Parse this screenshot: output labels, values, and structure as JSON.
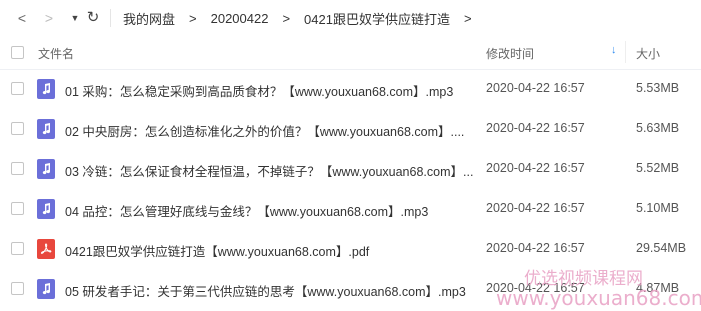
{
  "nav": {
    "back_glyph": "<",
    "forward_glyph": ">",
    "dropdown_glyph": "▼",
    "refresh_glyph": "↻"
  },
  "breadcrumb": {
    "items": [
      "我的网盘",
      "20200422",
      "0421跟巴奴学供应链打造"
    ],
    "separator": ">"
  },
  "header": {
    "name_label": "文件名",
    "time_label": "修改时间",
    "sort_arrow": "↓",
    "size_label": "大小"
  },
  "files": [
    {
      "type": "audio",
      "icon": "music-note-icon",
      "name": "01 采购：怎么稳定采购到高品质食材？【www.youxuan68.com】.mp3",
      "modified": "2020-04-22 16:57",
      "size": "5.53MB"
    },
    {
      "type": "audio",
      "icon": "music-note-icon",
      "name": "02 中央厨房：怎么创造标准化之外的价值？【www.youxuan68.com】....",
      "modified": "2020-04-22 16:57",
      "size": "5.63MB"
    },
    {
      "type": "audio",
      "icon": "music-note-icon",
      "name": "03 冷链：怎么保证食材全程恒温，不掉链子？【www.youxuan68.com】...",
      "modified": "2020-04-22 16:57",
      "size": "5.52MB"
    },
    {
      "type": "audio",
      "icon": "music-note-icon",
      "name": "04 品控：怎么管理好底线与金线？【www.youxuan68.com】.mp3",
      "modified": "2020-04-22 16:57",
      "size": "5.10MB"
    },
    {
      "type": "pdf",
      "icon": "pdf-icon",
      "name": "0421跟巴奴学供应链打造【www.youxuan68.com】.pdf",
      "modified": "2020-04-22 16:57",
      "size": "29.54MB"
    },
    {
      "type": "audio",
      "icon": "music-note-icon",
      "name": "05 研发者手记：关于第三代供应链的思考【www.youxuan68.com】.mp3",
      "modified": "2020-04-22 16:57",
      "size": "4.87MB"
    }
  ],
  "watermark": {
    "line1": "优选视频课程网",
    "line2": "www.youxuan68.com"
  },
  "colors": {
    "audio_icon": "#6b6fd9",
    "pdf_icon": "#e8473d",
    "sort_accent": "#2e8bf0",
    "watermark": "#e8a0c4"
  }
}
